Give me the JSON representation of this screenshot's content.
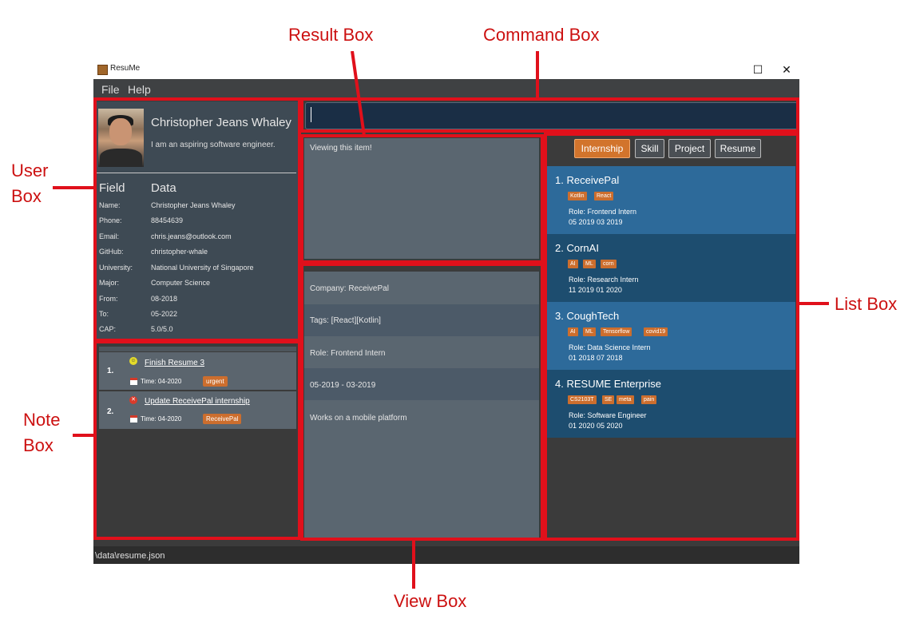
{
  "window": {
    "title": "ResuMe",
    "maximize_glyph": "☐",
    "close_glyph": "✕",
    "icon": "app-icon"
  },
  "menu": {
    "items": [
      "File",
      "Help"
    ]
  },
  "user": {
    "name": "Christopher Jeans Whaley",
    "bio": "I am an aspiring software engineer.",
    "field_header": "Field",
    "data_header": "Data",
    "fields": [
      {
        "label": "Name:",
        "value": "Christopher Jeans Whaley"
      },
      {
        "label": "Phone:",
        "value": "88454639"
      },
      {
        "label": "Email:",
        "value": "chris.jeans@outlook.com"
      },
      {
        "label": "GitHub:",
        "value": "christopher-whale"
      },
      {
        "label": "University:",
        "value": "National University of Singapore"
      },
      {
        "label": "Major:",
        "value": "Computer Science"
      },
      {
        "label": "From:",
        "value": "08-2018"
      },
      {
        "label": "To:",
        "value": "05-2022"
      },
      {
        "label": "CAP:",
        "value": "5.0/5.0"
      }
    ]
  },
  "command": {
    "value": ""
  },
  "result": {
    "text": "Viewing this item!"
  },
  "view": {
    "rows": [
      "Company: ReceivePal",
      "Tags: [React][Kotlin]",
      "Role: Frontend Intern",
      "05-2019 - 03-2019",
      "Works on a mobile platform"
    ]
  },
  "notes": [
    {
      "index": "1.",
      "status_icon": "smile-icon",
      "title": "Finish Resume 3",
      "time": "Time: 04-2020",
      "tag": "urgent"
    },
    {
      "index": "2.",
      "status_icon": "x-icon",
      "title": "Update ReceivePal internship",
      "time": "Time: 04-2020",
      "tag": "ReceivePal"
    }
  ],
  "tabs": [
    {
      "label": "Internship",
      "active": true
    },
    {
      "label": "Skill",
      "active": false
    },
    {
      "label": "Project",
      "active": false
    },
    {
      "label": "Resume",
      "active": false
    }
  ],
  "items": [
    {
      "index": "1.",
      "title": "ReceivePal",
      "tags": [
        "Kotlin",
        "React"
      ],
      "role": "Role: Frontend Intern",
      "dates": "05 2019   03 2019",
      "bg": "#2d6a9a"
    },
    {
      "index": "2.",
      "title": "CornAI",
      "tags": [
        "AI",
        "ML",
        "corn"
      ],
      "role": "Role: Research Intern",
      "dates": "11 2019   01 2020",
      "bg": "#1d4d6f"
    },
    {
      "index": "3.",
      "title": "CoughTech",
      "tags": [
        "AI",
        "ML",
        "Tensorflow",
        "covid19"
      ],
      "role": "Role: Data Science Intern",
      "dates": "01 2018   07 2018",
      "bg": "#2d6a9a"
    },
    {
      "index": "4.",
      "title": "RESUME Enterprise",
      "tags": [
        "CS2103T",
        "SE",
        "meta",
        "pain"
      ],
      "role": "Role: Software Engineer",
      "dates": "01 2020   05 2020",
      "bg": "#1d4d6f"
    }
  ],
  "status_bar": {
    "path": "\\data\\resume.json"
  },
  "annotations": {
    "result_box": "Result Box",
    "command_box": "Command Box",
    "user_box_line1": "User",
    "user_box_line2": "Box",
    "note_box_line1": "Note",
    "note_box_line2": "Box",
    "list_box": "List Box",
    "view_box": "View Box"
  },
  "colors": {
    "accent_orange": "#d2742c",
    "annotation_red": "#e0101b",
    "list_item_light": "#2d6a9a",
    "list_item_dark": "#1d4d6f"
  }
}
